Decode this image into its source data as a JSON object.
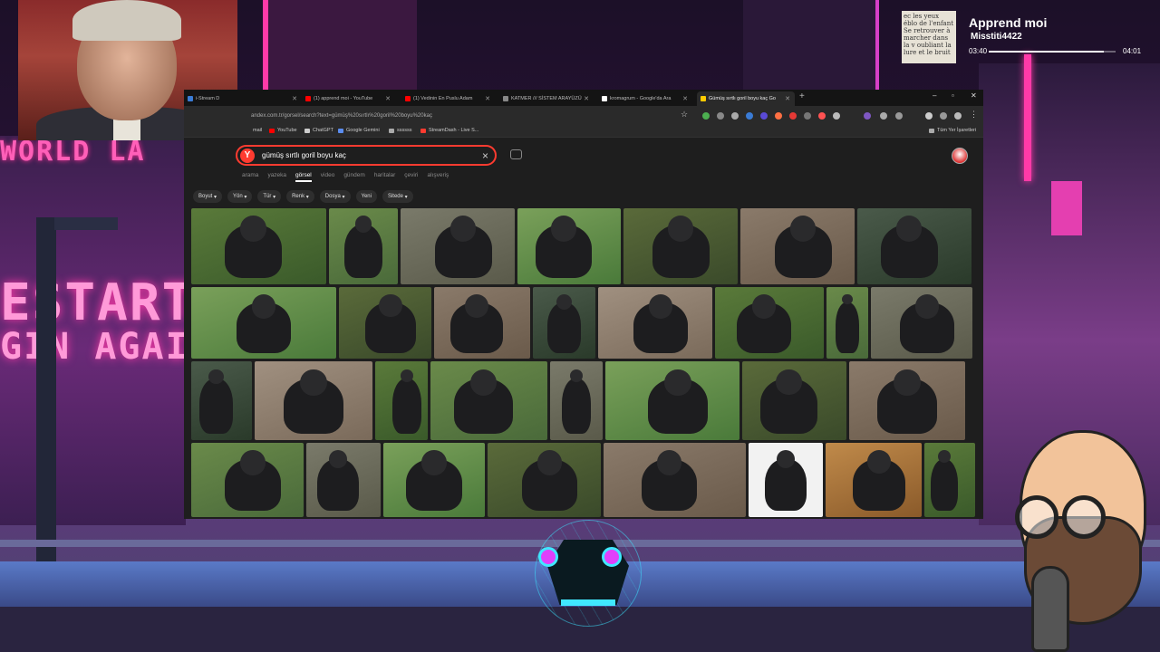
{
  "music": {
    "title": "Apprend moi",
    "artist": "Misstiti4422",
    "elapsed": "03:40",
    "duration": "04:01",
    "progress": 0.91,
    "art_text": "ec les yeux éblo de l'enfant Se retrouver à marcher dans la v oubliant la lure et le bruit"
  },
  "browser": {
    "tabs": [
      {
        "label": "i-Stream D",
        "color": "#3a7bd5"
      },
      {
        "label": "(1) apprend moi - YouTube",
        "color": "#ff0000"
      },
      {
        "label": "(1) Vedinin En Puslu Adam",
        "color": "#ff0000"
      },
      {
        "label": "KATMER /// SİSTEM ARAYÜZÜ",
        "color": "#888888"
      },
      {
        "label": "kromagrum - Google'da Ara",
        "color": "#ffffff"
      },
      {
        "label": "Gümüş sırtlı goril boyu kaç Go",
        "color": "#ffcc00"
      }
    ],
    "url": "andex.com.tr/gorsel/search?text=gümüş%20sırtlı%20goril%20boyu%20kaç",
    "bookmarks": [
      {
        "label": "mail",
        "color": "#888888"
      },
      {
        "label": "YouTube",
        "color": "#ff0000"
      },
      {
        "label": "ChatGPT",
        "color": "#cccccc"
      },
      {
        "label": "Google Gemini",
        "color": "#5b8def"
      },
      {
        "label": "ssssss",
        "color": "#aaaaaa"
      },
      {
        "label": "StreamDash - Live S...",
        "color": "#ff3b30"
      }
    ],
    "all_bookmarks": "Tüm Yer İşaretleri"
  },
  "search": {
    "logo": "Y",
    "query": "gümüş sırtlı goril boyu kaç",
    "tabs": [
      "arama",
      "yazeka",
      "görsel",
      "video",
      "gündem",
      "haritalar",
      "çeviri",
      "alışveriş"
    ],
    "active_tab": "görsel",
    "filters": [
      "Boyut",
      "Yön",
      "Tür",
      "Renk",
      "Dosya",
      "Yeni",
      "Sitede"
    ]
  },
  "colors": {
    "accent": "#ff3b30",
    "browser_bg": "#1e1e1e"
  }
}
